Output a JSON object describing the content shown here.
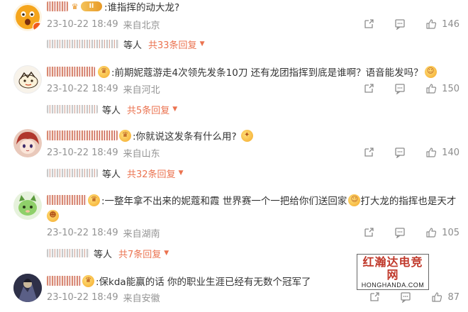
{
  "comments": [
    {
      "text": ":谁指挥的动大龙?",
      "emoji": "",
      "badge_level": "II",
      "date": "23-10-22 18:49",
      "location": "来自北京",
      "likes": "146",
      "replies_people": "等人",
      "replies_link": "共33条回复",
      "avatar_icon": "surprised-emoji-avatar",
      "avatar_color": "#f4a21d"
    },
    {
      "text": ":前期妮蔻游走4次领先发条10刀 还有龙团指挥到底是谁啊？语音能发吗？",
      "emoji": "",
      "badge_level": "",
      "date": "23-10-22 18:49",
      "location": "来自河北",
      "likes": "150",
      "replies_people": "等人",
      "replies_link": "共5条回复",
      "avatar_icon": "cartoon-character-avatar",
      "avatar_color": "#f6f0e6"
    },
    {
      "text": ":你就说这发条有什么用?",
      "emoji": "",
      "badge_level": "",
      "date": "23-10-22 18:49",
      "location": "来自山东",
      "likes": "140",
      "replies_people": "等人",
      "replies_link": "共32条回复",
      "avatar_icon": "anime-girl-avatar",
      "avatar_color": "#b84a3a"
    },
    {
      "text": ":一整年拿不出来的妮蔻和霞 世界赛一个一把给你们送回家",
      "text2": "打大龙的指挥也是天才",
      "emoji": "",
      "badge_level": "",
      "date": "23-10-22 18:49",
      "location": "来自湖南",
      "likes": "105",
      "replies_people": "等人",
      "replies_link": "共7条回复",
      "avatar_icon": "green-cat-avatar",
      "avatar_color": "#7cc46a"
    },
    {
      "text": ":保kda能赢的话 你的职业生涯已经有无数个冠军了",
      "emoji": "",
      "badge_level": "",
      "date": "23-10-22 18:49",
      "location": "来自安徽",
      "likes": "87",
      "replies_people": "",
      "replies_link": "",
      "avatar_icon": "dark-character-avatar",
      "avatar_color": "#4a4a66"
    }
  ],
  "watermark": {
    "cn": "红瀚达电竞网",
    "en": "HONGHANDA.COM"
  },
  "colors": {
    "meta_gray": "#939393",
    "reply_orange": "#eb7350",
    "icon_gray": "#8c8c8c"
  }
}
